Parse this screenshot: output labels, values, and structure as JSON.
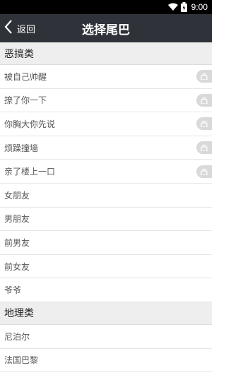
{
  "status_bar": {
    "time": "9:00",
    "icons": [
      "wifi-icon",
      "battery-charging-icon"
    ]
  },
  "header": {
    "back_label": "返回",
    "title": "选择尾巴"
  },
  "sections": [
    {
      "title": "恶搞类",
      "items": [
        {
          "label": "被自己帅醒",
          "locked": true
        },
        {
          "label": "撩了你一下",
          "locked": true
        },
        {
          "label": "你胸大你先说",
          "locked": true
        },
        {
          "label": "烦躁撞墙",
          "locked": true
        },
        {
          "label": "亲了楼上一口",
          "locked": true
        },
        {
          "label": "女朋友",
          "locked": false
        },
        {
          "label": "男朋友",
          "locked": false
        },
        {
          "label": "前男友",
          "locked": false
        },
        {
          "label": "前女友",
          "locked": false
        },
        {
          "label": "爷爷",
          "locked": false
        }
      ]
    },
    {
      "title": "地理类",
      "items": [
        {
          "label": "尼泊尔",
          "locked": false
        },
        {
          "label": "法国巴黎",
          "locked": false
        }
      ]
    }
  ],
  "colors": {
    "title_bar": "#2f3238",
    "section_bg": "#eeeeee",
    "lock_badge": "#d9d9d9"
  }
}
